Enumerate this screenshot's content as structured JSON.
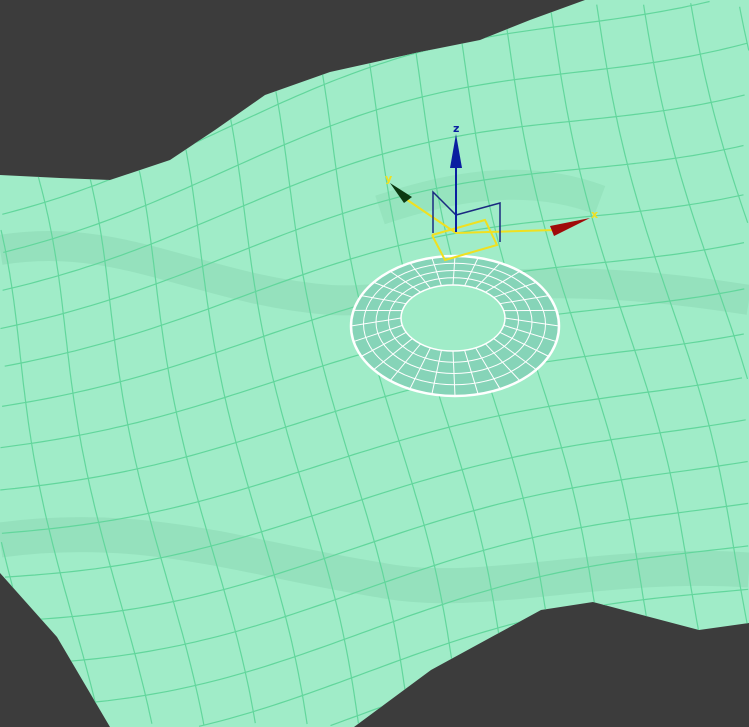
{
  "viewport": {
    "background": "#3c3c3c",
    "surface_color": "#a0ecc8",
    "grid_color": "#62d69c",
    "torus_fill": "#86d4b8",
    "wire_color": "#ffffff"
  },
  "gizmo": {
    "z_label": "z",
    "y_label": "y",
    "x_label": "x",
    "z_color": "#0a1ea0",
    "y_color": "#0c3a12",
    "x_color": "#a00a0a",
    "plane_color": "#f0e020"
  }
}
